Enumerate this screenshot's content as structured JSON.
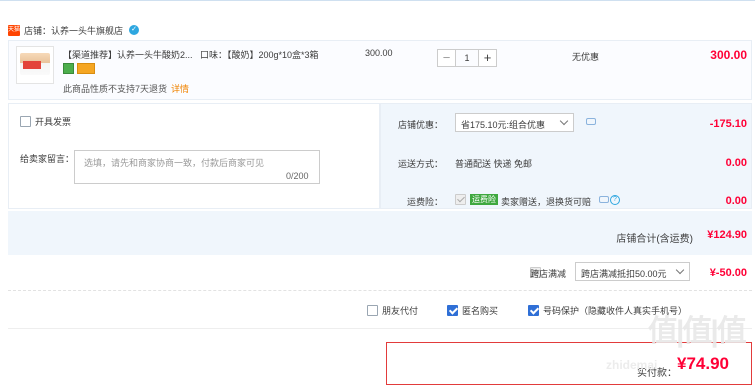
{
  "shop": {
    "badge": "天猫",
    "label": "店铺：认养一头牛旗舰店"
  },
  "item": {
    "title": "【渠道推荐】认养一头牛酸奶2...",
    "sku": "口味：【酸奶】200g*10盒*3箱",
    "unit_price": "300.00",
    "quantity": "1",
    "minus": "−",
    "plus": "+",
    "promo": "无优惠",
    "total": "300.00",
    "return_note": "此商品性质不支持7天退货",
    "detail_link": "详情"
  },
  "invoice": {
    "label": "开具发票"
  },
  "message": {
    "label": "给卖家留言：",
    "placeholder": "选填，请先和商家协商一致，付款后商家可见",
    "count": "0/200"
  },
  "coupon": {
    "label": "店铺优惠：",
    "value": "省175.10元:组合优惠",
    "amount": "-175.10"
  },
  "shipping": {
    "label": "运送方式：",
    "mode": "普通配送 快递 免邮",
    "amount": "0.00"
  },
  "insurance": {
    "label": "运费险：",
    "tag": "运费险",
    "text": "卖家赠送，退换货可赔",
    "amount": "0.00"
  },
  "shop_total": {
    "label": "店铺合计(含运费)",
    "amount": "¥124.90"
  },
  "cross_store": {
    "label": "跨店满减",
    "value": "跨店满减抵扣50.00元",
    "amount": "¥-50.00"
  },
  "options": [
    {
      "label": "朋友代付",
      "checked": false
    },
    {
      "label": "匿名购买",
      "checked": true
    },
    {
      "label": "号码保护（隐藏收件人真实手机号）",
      "checked": true
    }
  ],
  "payment": {
    "label": "实付款：",
    "amount": "¥74.90"
  },
  "watermark": {
    "text": "值|值|值",
    "sub": "zhidemai"
  },
  "colors": {
    "accent_red": "#ff0036",
    "brand_blue": "#2f6fd6",
    "bg_light": "#f0f6fc"
  }
}
